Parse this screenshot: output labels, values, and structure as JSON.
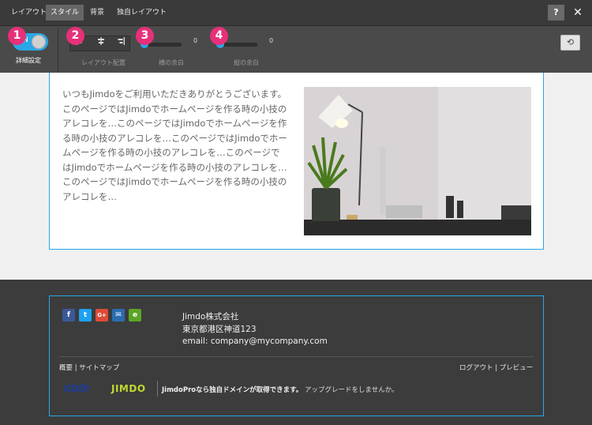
{
  "tabs": [
    {
      "label": "レイアウト",
      "active": false
    },
    {
      "label": "スタイル",
      "active": true
    },
    {
      "label": "背景",
      "active": false
    },
    {
      "label": "独自レイアウト",
      "active": false
    }
  ],
  "topbar": {
    "help": "?",
    "close": "✕"
  },
  "toolbar": {
    "toggle_label": "ON",
    "toggle_state": "on",
    "detail_label": "詳細設定",
    "align_label": "レイアウト配置",
    "h_margin_label": "横の余白",
    "h_margin_value": "0",
    "v_margin_label": "縦の余白",
    "v_margin_value": "0",
    "reset_icon": "⟲"
  },
  "badges": [
    "1",
    "2",
    "3",
    "4"
  ],
  "content": {
    "paragraph": "いつもJimdoをご利用いただきありがとうございます。このページではJimdoでホームページを作る時の小技のアレコレを…このページではJimdoでホームページを作る時の小技のアレコレを…このページではJimdoでホームページを作る時の小技のアレコレを…このページではJimdoでホームページを作る時の小技のアレコレを…このページではJimdoでホームページを作る時の小技のアレコレを…"
  },
  "footer": {
    "social": [
      {
        "name": "facebook",
        "glyph": "f",
        "color": "#3b5998"
      },
      {
        "name": "twitter",
        "glyph": "t",
        "color": "#1da1f2"
      },
      {
        "name": "google-plus",
        "glyph": "G+",
        "color": "#dd4b39"
      },
      {
        "name": "mail",
        "glyph": "✉",
        "color": "#2a6cb0"
      },
      {
        "name": "evernote",
        "glyph": "e",
        "color": "#5ba525"
      }
    ],
    "company": "Jimdo株式会社",
    "address": "東京都港区神道123",
    "email": "email: company@mycompany.com",
    "links_left": "概要 | サイトマップ",
    "links_right": "ログアウト | プレビュー",
    "kddi": "KDDI",
    "jimdo": "JIMDO",
    "promo_bold": "JimdoProなら独自ドメインが取得できます。",
    "promo_normal": "アップグレードをしませんか。"
  }
}
